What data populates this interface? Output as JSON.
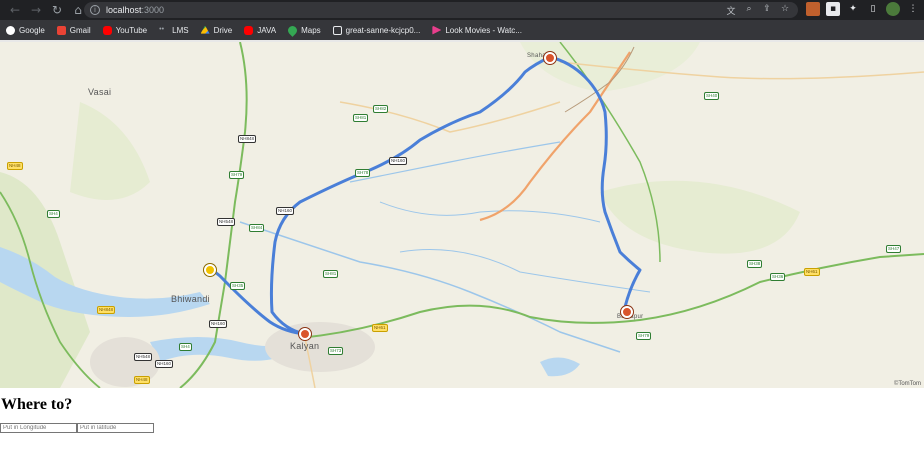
{
  "browser": {
    "url_host": "localhost",
    "url_port": ":3000",
    "nav_icons": [
      "back-arrow-icon",
      "forward-arrow-icon",
      "reload-icon",
      "home-icon"
    ],
    "omnibox_icons": [
      "translate-icon",
      "zoom-icon",
      "share-icon",
      "bookmark-star-icon"
    ],
    "extension_icons": [
      "extension-a-icon",
      "extension-b-icon",
      "puzzle-icon",
      "side-panel-icon",
      "profile-avatar-icon",
      "more-menu-icon"
    ]
  },
  "bookmarks": [
    {
      "label": "Google",
      "icon": "google-icon",
      "color": "#4285f4"
    },
    {
      "label": "Gmail",
      "icon": "gmail-icon",
      "color": "#ea4335"
    },
    {
      "label": "YouTube",
      "icon": "youtube-icon",
      "color": "#ff0000"
    },
    {
      "label": "LMS",
      "icon": "lms-icon",
      "color": "#9aa0a6"
    },
    {
      "label": "Drive",
      "icon": "drive-icon",
      "color": "#fbbc04"
    },
    {
      "label": "JAVA",
      "icon": "youtube-icon",
      "color": "#ff0000"
    },
    {
      "label": "Maps",
      "icon": "maps-icon",
      "color": "#34a853"
    },
    {
      "label": "great-sanne-kcjcp0...",
      "icon": "page-icon",
      "color": "#e8eaed"
    },
    {
      "label": "Look Movies - Watc...",
      "icon": "play-icon",
      "color": "#e83e8c"
    }
  ],
  "map": {
    "labels": {
      "vasai": "Vasai",
      "bhiwandi": "Bhiwandi",
      "kalyan": "Kalyan",
      "shahapur": "Shaha",
      "badlapur": "Badlapur"
    },
    "attribution": "©TomTom",
    "route_color": "#4a7fd8",
    "shields": {
      "s1": "NH48",
      "s2": "SH4",
      "s3": "NH848",
      "s4": "SH79",
      "s5": "SH35",
      "s6": "NH160",
      "s7": "SH84",
      "s8": "NH548",
      "s9": "NH160",
      "s10": "SH81",
      "s11": "SH82",
      "s12": "SH40",
      "s13": "SH38",
      "s14": "SH36",
      "s15": "NH61",
      "s16": "SH79",
      "s17": "SH47",
      "s18": "NH160",
      "s19": "SH4",
      "s20": "SH73",
      "s21": "NH61",
      "s22": "NH548",
      "s23": "NH848",
      "s24": "NH48",
      "s25": "SH78",
      "s26": "NH160",
      "s27": "SH81"
    }
  },
  "form": {
    "heading": "Where to?",
    "longitude_placeholder": "Put in Longitude",
    "latitude_placeholder": "Put in latitude"
  }
}
